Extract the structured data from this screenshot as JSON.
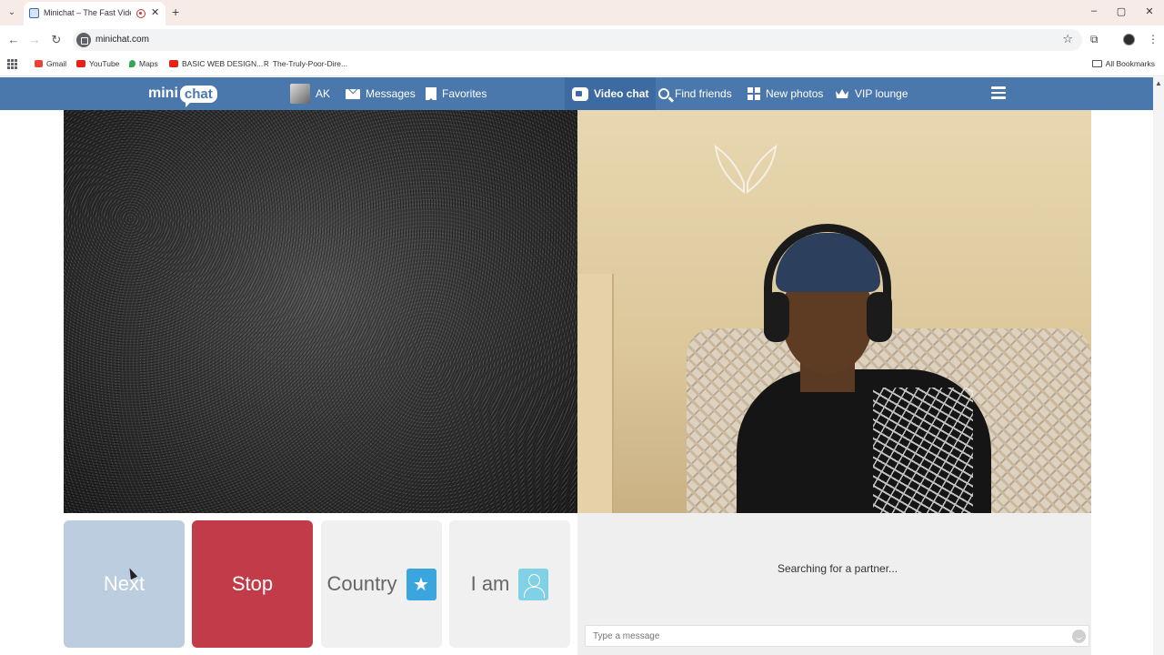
{
  "browser": {
    "tab_title": "Minichat – The Fast Video C",
    "url": "minichat.com",
    "bookmarks": [
      "Gmail",
      "YouTube",
      "Maps",
      "BASIC WEB DESIGN...",
      "The-Truly-Poor-Dire..."
    ],
    "all_bookmarks": "All Bookmarks"
  },
  "header": {
    "logo_left": "mini",
    "logo_right": "chat",
    "user": "AK",
    "nav": [
      "Messages",
      "Favorites",
      "Video chat",
      "Find friends",
      "New photos",
      "VIP lounge"
    ],
    "active_nav": "Video chat",
    "color": "#4a78ad"
  },
  "controls": {
    "next": "Next",
    "stop": "Stop",
    "country": "Country",
    "iam": "I am",
    "stop_color": "#c13b48",
    "next_color": "#bccddf"
  },
  "chat": {
    "status": "Searching for a partner...",
    "placeholder": "Type a message"
  },
  "icons": [
    "search-icon",
    "star-icon",
    "envelope-icon",
    "bookmark-icon",
    "camera-icon",
    "photos-icon",
    "crown-icon",
    "menu-icon",
    "emoji-icon"
  ]
}
